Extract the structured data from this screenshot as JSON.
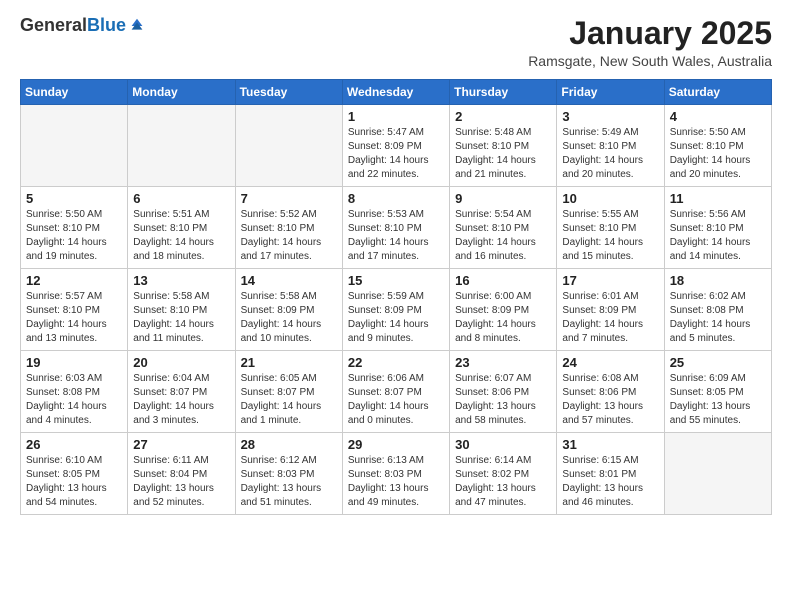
{
  "logo": {
    "general": "General",
    "blue": "Blue"
  },
  "header": {
    "month": "January 2025",
    "location": "Ramsgate, New South Wales, Australia"
  },
  "weekdays": [
    "Sunday",
    "Monday",
    "Tuesday",
    "Wednesday",
    "Thursday",
    "Friday",
    "Saturday"
  ],
  "weeks": [
    [
      {
        "day": "",
        "sunrise": "",
        "sunset": "",
        "daylight": ""
      },
      {
        "day": "",
        "sunrise": "",
        "sunset": "",
        "daylight": ""
      },
      {
        "day": "",
        "sunrise": "",
        "sunset": "",
        "daylight": ""
      },
      {
        "day": "1",
        "sunrise": "Sunrise: 5:47 AM",
        "sunset": "Sunset: 8:09 PM",
        "daylight": "Daylight: 14 hours and 22 minutes."
      },
      {
        "day": "2",
        "sunrise": "Sunrise: 5:48 AM",
        "sunset": "Sunset: 8:10 PM",
        "daylight": "Daylight: 14 hours and 21 minutes."
      },
      {
        "day": "3",
        "sunrise": "Sunrise: 5:49 AM",
        "sunset": "Sunset: 8:10 PM",
        "daylight": "Daylight: 14 hours and 20 minutes."
      },
      {
        "day": "4",
        "sunrise": "Sunrise: 5:50 AM",
        "sunset": "Sunset: 8:10 PM",
        "daylight": "Daylight: 14 hours and 20 minutes."
      }
    ],
    [
      {
        "day": "5",
        "sunrise": "Sunrise: 5:50 AM",
        "sunset": "Sunset: 8:10 PM",
        "daylight": "Daylight: 14 hours and 19 minutes."
      },
      {
        "day": "6",
        "sunrise": "Sunrise: 5:51 AM",
        "sunset": "Sunset: 8:10 PM",
        "daylight": "Daylight: 14 hours and 18 minutes."
      },
      {
        "day": "7",
        "sunrise": "Sunrise: 5:52 AM",
        "sunset": "Sunset: 8:10 PM",
        "daylight": "Daylight: 14 hours and 17 minutes."
      },
      {
        "day": "8",
        "sunrise": "Sunrise: 5:53 AM",
        "sunset": "Sunset: 8:10 PM",
        "daylight": "Daylight: 14 hours and 17 minutes."
      },
      {
        "day": "9",
        "sunrise": "Sunrise: 5:54 AM",
        "sunset": "Sunset: 8:10 PM",
        "daylight": "Daylight: 14 hours and 16 minutes."
      },
      {
        "day": "10",
        "sunrise": "Sunrise: 5:55 AM",
        "sunset": "Sunset: 8:10 PM",
        "daylight": "Daylight: 14 hours and 15 minutes."
      },
      {
        "day": "11",
        "sunrise": "Sunrise: 5:56 AM",
        "sunset": "Sunset: 8:10 PM",
        "daylight": "Daylight: 14 hours and 14 minutes."
      }
    ],
    [
      {
        "day": "12",
        "sunrise": "Sunrise: 5:57 AM",
        "sunset": "Sunset: 8:10 PM",
        "daylight": "Daylight: 14 hours and 13 minutes."
      },
      {
        "day": "13",
        "sunrise": "Sunrise: 5:58 AM",
        "sunset": "Sunset: 8:10 PM",
        "daylight": "Daylight: 14 hours and 11 minutes."
      },
      {
        "day": "14",
        "sunrise": "Sunrise: 5:58 AM",
        "sunset": "Sunset: 8:09 PM",
        "daylight": "Daylight: 14 hours and 10 minutes."
      },
      {
        "day": "15",
        "sunrise": "Sunrise: 5:59 AM",
        "sunset": "Sunset: 8:09 PM",
        "daylight": "Daylight: 14 hours and 9 minutes."
      },
      {
        "day": "16",
        "sunrise": "Sunrise: 6:00 AM",
        "sunset": "Sunset: 8:09 PM",
        "daylight": "Daylight: 14 hours and 8 minutes."
      },
      {
        "day": "17",
        "sunrise": "Sunrise: 6:01 AM",
        "sunset": "Sunset: 8:09 PM",
        "daylight": "Daylight: 14 hours and 7 minutes."
      },
      {
        "day": "18",
        "sunrise": "Sunrise: 6:02 AM",
        "sunset": "Sunset: 8:08 PM",
        "daylight": "Daylight: 14 hours and 5 minutes."
      }
    ],
    [
      {
        "day": "19",
        "sunrise": "Sunrise: 6:03 AM",
        "sunset": "Sunset: 8:08 PM",
        "daylight": "Daylight: 14 hours and 4 minutes."
      },
      {
        "day": "20",
        "sunrise": "Sunrise: 6:04 AM",
        "sunset": "Sunset: 8:07 PM",
        "daylight": "Daylight: 14 hours and 3 minutes."
      },
      {
        "day": "21",
        "sunrise": "Sunrise: 6:05 AM",
        "sunset": "Sunset: 8:07 PM",
        "daylight": "Daylight: 14 hours and 1 minute."
      },
      {
        "day": "22",
        "sunrise": "Sunrise: 6:06 AM",
        "sunset": "Sunset: 8:07 PM",
        "daylight": "Daylight: 14 hours and 0 minutes."
      },
      {
        "day": "23",
        "sunrise": "Sunrise: 6:07 AM",
        "sunset": "Sunset: 8:06 PM",
        "daylight": "Daylight: 13 hours and 58 minutes."
      },
      {
        "day": "24",
        "sunrise": "Sunrise: 6:08 AM",
        "sunset": "Sunset: 8:06 PM",
        "daylight": "Daylight: 13 hours and 57 minutes."
      },
      {
        "day": "25",
        "sunrise": "Sunrise: 6:09 AM",
        "sunset": "Sunset: 8:05 PM",
        "daylight": "Daylight: 13 hours and 55 minutes."
      }
    ],
    [
      {
        "day": "26",
        "sunrise": "Sunrise: 6:10 AM",
        "sunset": "Sunset: 8:05 PM",
        "daylight": "Daylight: 13 hours and 54 minutes."
      },
      {
        "day": "27",
        "sunrise": "Sunrise: 6:11 AM",
        "sunset": "Sunset: 8:04 PM",
        "daylight": "Daylight: 13 hours and 52 minutes."
      },
      {
        "day": "28",
        "sunrise": "Sunrise: 6:12 AM",
        "sunset": "Sunset: 8:03 PM",
        "daylight": "Daylight: 13 hours and 51 minutes."
      },
      {
        "day": "29",
        "sunrise": "Sunrise: 6:13 AM",
        "sunset": "Sunset: 8:03 PM",
        "daylight": "Daylight: 13 hours and 49 minutes."
      },
      {
        "day": "30",
        "sunrise": "Sunrise: 6:14 AM",
        "sunset": "Sunset: 8:02 PM",
        "daylight": "Daylight: 13 hours and 47 minutes."
      },
      {
        "day": "31",
        "sunrise": "Sunrise: 6:15 AM",
        "sunset": "Sunset: 8:01 PM",
        "daylight": "Daylight: 13 hours and 46 minutes."
      },
      {
        "day": "",
        "sunrise": "",
        "sunset": "",
        "daylight": ""
      }
    ]
  ]
}
